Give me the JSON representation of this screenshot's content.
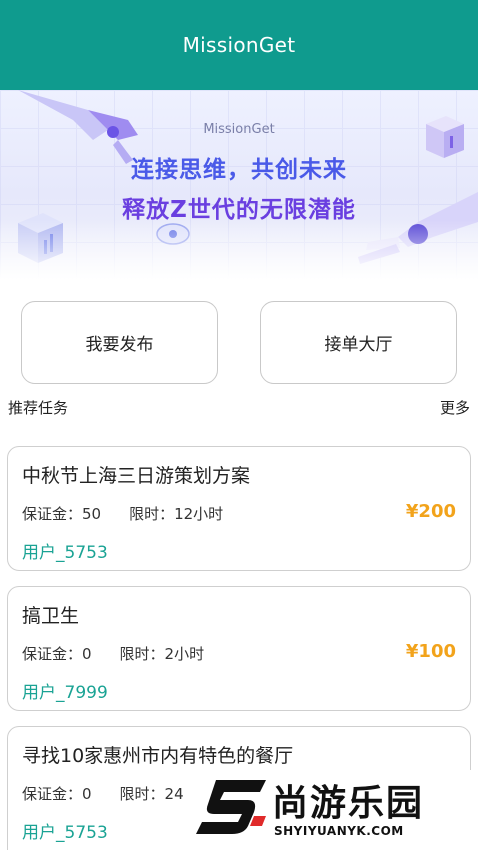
{
  "app_bar": {
    "title": "MissionGet"
  },
  "banner": {
    "brand": "MissionGet",
    "slogan_line1": "连接思维，共创未来",
    "slogan_line2": "释放Z世代的无限潜能"
  },
  "actions": {
    "publish_label": "我要发布",
    "hall_label": "接单大厅"
  },
  "section": {
    "title": "推荐任务",
    "more_label": "更多"
  },
  "tasks": [
    {
      "title": "中秋节上海三日游策划方案",
      "deposit": "保证金：50",
      "limit": "限时：12小时",
      "price": "¥200",
      "user": "用户_5753"
    },
    {
      "title": "搞卫生",
      "deposit": "保证金：0",
      "limit": "限时：2小时",
      "price": "¥100",
      "user": "用户_7999"
    },
    {
      "title": "寻找10家惠州市内有特色的餐厅",
      "deposit": "保证金：0",
      "limit": "限时：24",
      "price": "",
      "user": "用户_5753"
    }
  ],
  "watermark": {
    "text": "尚游乐园",
    "url": "SHYIYUANYK.COM"
  },
  "colors": {
    "primary": "#0f9b8e",
    "price": "#f2a31b",
    "user": "#1aa394"
  }
}
